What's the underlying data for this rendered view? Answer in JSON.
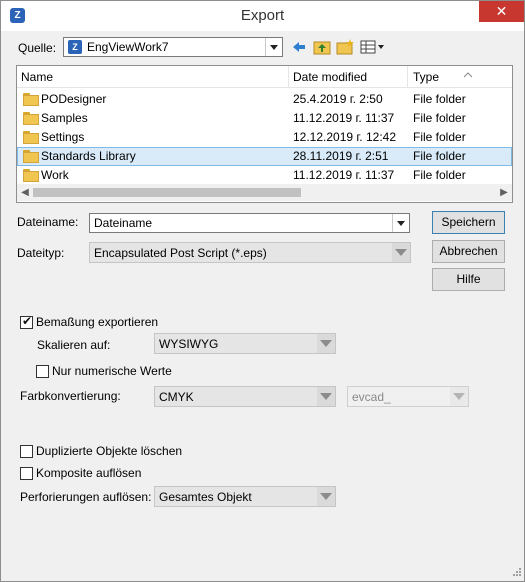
{
  "window": {
    "title": "Export",
    "app_icon": "engview-logo-icon",
    "close_glyph": "✕"
  },
  "source": {
    "label": "Quelle:",
    "value": "EngViewWork7",
    "toolbar_icons": [
      "back-arrow-icon",
      "up-folder-icon",
      "new-folder-icon",
      "view-menu-icon"
    ]
  },
  "filelist": {
    "columns": [
      "Name",
      "Date modified",
      "Type"
    ],
    "rows": [
      {
        "name": "PODesigner",
        "date": "25.4.2019 г. 2:50",
        "type": "File folder",
        "selected": false
      },
      {
        "name": "Samples",
        "date": "11.12.2019 г. 11:37",
        "type": "File folder",
        "selected": false
      },
      {
        "name": "Settings",
        "date": "12.12.2019 г. 12:42",
        "type": "File folder",
        "selected": false
      },
      {
        "name": "Standards Library",
        "date": "28.11.2019 г. 2:51",
        "type": "File folder",
        "selected": true
      },
      {
        "name": "Work",
        "date": "11.12.2019 г. 11:37",
        "type": "File folder",
        "selected": false
      }
    ]
  },
  "filename": {
    "label": "Dateiname:",
    "value": "Dateiname"
  },
  "filetype": {
    "label": "Dateityp:",
    "value": "Encapsulated Post Script (*.eps)"
  },
  "buttons": {
    "save": "Speichern",
    "cancel": "Abbrechen",
    "help": "Hilfe"
  },
  "options": {
    "export_dimensions": {
      "label": "Bemaßung exportieren",
      "checked": true
    },
    "scale": {
      "label": "Skalieren auf:",
      "value": "WYSIWYG"
    },
    "numeric_only": {
      "label": "Nur numerische Werte",
      "checked": false
    },
    "color_conversion": {
      "label": "Farbkonvertierung:",
      "value": "CMYK",
      "secondary_value": "evcad_"
    },
    "delete_duplicates": {
      "label": "Duplizierte Objekte löschen",
      "checked": false
    },
    "explode_composites": {
      "label": "Komposite auflösen",
      "checked": false
    },
    "perforations": {
      "label": "Perforierungen auflösen:",
      "value": "Gesamtes Objekt"
    }
  },
  "colors": {
    "selection": "#d9ebf8",
    "selection_border": "#7fb9e6",
    "close": "#c7372f",
    "folder": "#f0c550"
  }
}
